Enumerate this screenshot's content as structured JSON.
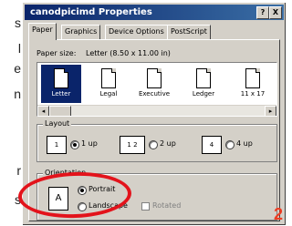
{
  "left_strip_chars": [
    "s",
    "l",
    "e",
    "n",
    "r",
    "s"
  ],
  "dialog": {
    "title": "canodpicimd Properties",
    "title_buttons": [
      "?",
      "X"
    ],
    "tabs": [
      "Paper",
      "Graphics",
      "Device Options",
      "PostScript"
    ],
    "paper_size_label": "Paper size:",
    "paper_size_value": "Letter (8.50 x 11.00 in)",
    "paper_items": [
      "Letter",
      "Legal",
      "Executive",
      "Ledger",
      "11 x 17"
    ],
    "layout": {
      "title": "Layout",
      "options": [
        "1 up",
        "2 up",
        "4 up"
      ],
      "selected": "1 up"
    },
    "orientation": {
      "title": "Orientation",
      "options": [
        "Portrait",
        "Landscape"
      ],
      "selected": "Portrait",
      "rotated_label": "Rotated"
    }
  },
  "annotation": {
    "step_number": "2",
    "highlight_color": "#e3131b"
  },
  "colors": {
    "titlebar": "#0a246a",
    "face": "#d4d0c8",
    "selection": "#0a246a"
  }
}
